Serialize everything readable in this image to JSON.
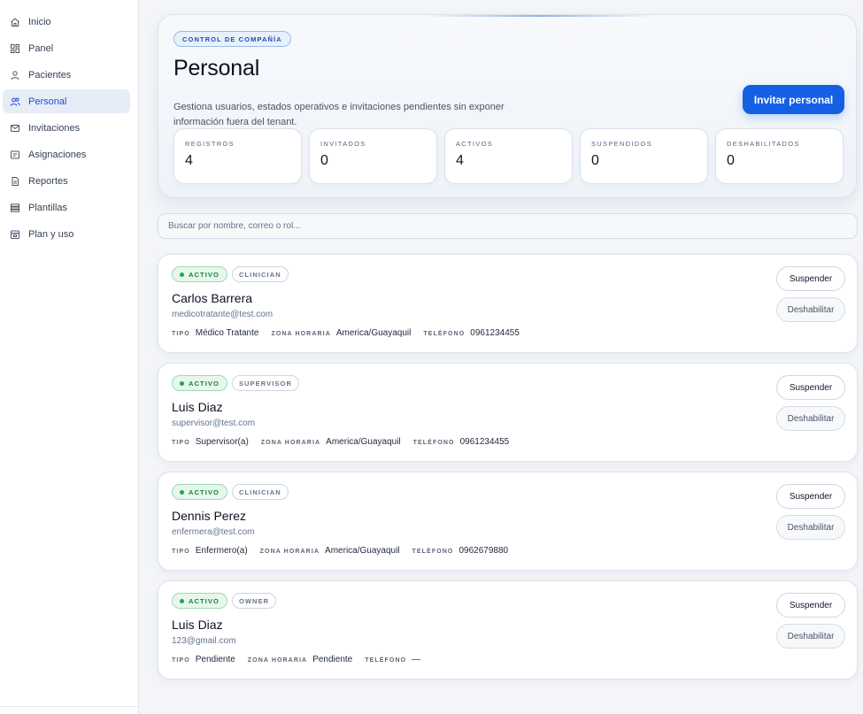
{
  "sidebar": {
    "items": [
      {
        "label": "Inicio",
        "icon": "home-icon"
      },
      {
        "label": "Panel",
        "icon": "dashboard-icon"
      },
      {
        "label": "Pacientes",
        "icon": "user-icon"
      },
      {
        "label": "Personal",
        "icon": "users-icon",
        "active": true
      },
      {
        "label": "Invitaciones",
        "icon": "mail-icon"
      },
      {
        "label": "Asignaciones",
        "icon": "assignment-icon"
      },
      {
        "label": "Reportes",
        "icon": "document-icon"
      },
      {
        "label": "Plantillas",
        "icon": "template-icon"
      },
      {
        "label": "Plan y uso",
        "icon": "plan-icon"
      }
    ]
  },
  "hero": {
    "pill": "CONTROL DE COMPAÑÍA",
    "title": "Personal",
    "description": "Gestiona usuarios, estados operativos e invitaciones pendientes sin exponer información fuera del tenant.",
    "invite_label": "Invitar personal"
  },
  "stats": [
    {
      "label": "REGISTROS",
      "value": "4"
    },
    {
      "label": "INVITADOS",
      "value": "0"
    },
    {
      "label": "ACTIVOS",
      "value": "4"
    },
    {
      "label": "SUSPENDIDOS",
      "value": "0"
    },
    {
      "label": "DESHABILITADOS",
      "value": "0"
    }
  ],
  "search": {
    "placeholder": "Buscar por nombre, correo o rol..."
  },
  "staff": [
    {
      "status": "ACTIVO",
      "role": "CLINICIAN",
      "name": "Carlos Barrera",
      "email": "medicotratante@test.com",
      "tipo_label": "TIPO",
      "tipo": "Médico Tratante",
      "zona_label": "ZONA HORARIA",
      "zona": "America/Guayaquil",
      "telefono_label": "TELÉFONO",
      "telefono": "0961234455",
      "suspend_label": "Suspender",
      "disable_label": "Deshabilitar"
    },
    {
      "status": "ACTIVO",
      "role": "SUPERVISOR",
      "name": "Luis Diaz",
      "email": "supervisor@test.com",
      "tipo_label": "TIPO",
      "tipo": "Supervisor(a)",
      "zona_label": "ZONA HORARIA",
      "zona": "America/Guayaquil",
      "telefono_label": "TELÉFONO",
      "telefono": "0961234455",
      "suspend_label": "Suspender",
      "disable_label": "Deshabilitar"
    },
    {
      "status": "ACTIVO",
      "role": "CLINICIAN",
      "name": "Dennis Perez",
      "email": "enfermera@test.com",
      "tipo_label": "TIPO",
      "tipo": "Enfermero(a)",
      "zona_label": "ZONA HORARIA",
      "zona": "America/Guayaquil",
      "telefono_label": "TELÉFONO",
      "telefono": "0962679880",
      "suspend_label": "Suspender",
      "disable_label": "Deshabilitar"
    },
    {
      "status": "ACTIVO",
      "role": "OWNER",
      "name": "Luis Diaz",
      "email": "123@gmail.com",
      "tipo_label": "TIPO",
      "tipo": "Pendiente",
      "zona_label": "ZONA HORARIA",
      "zona": "Pendiente",
      "telefono_label": "TELÉFONO",
      "telefono": "—",
      "suspend_label": "Suspender",
      "disable_label": "Deshabilitar"
    }
  ],
  "colors": {
    "accent": "#1460e5",
    "active_nav": "#1d4ed8",
    "status_green": "#15803d"
  }
}
